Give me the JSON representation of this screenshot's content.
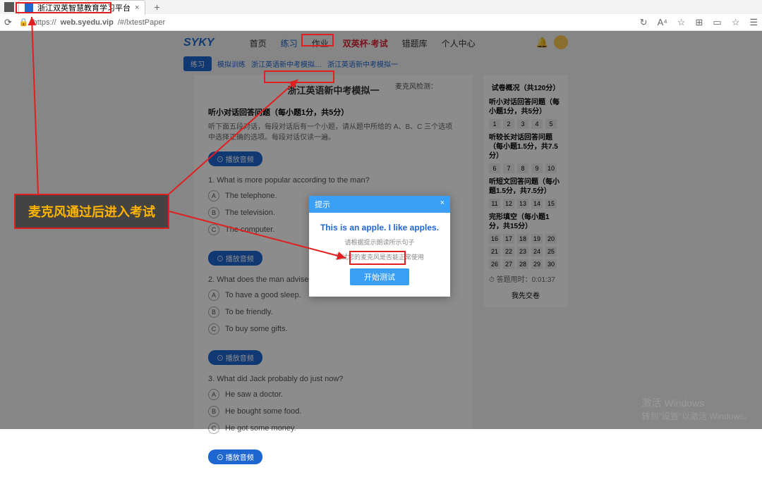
{
  "browser": {
    "tab_title": "浙江双英智慧教育学习平台",
    "tab_close": "×",
    "new_tab": "+",
    "reload": "⟳",
    "lock": "🔒",
    "url_prefix": "https://",
    "url_host": "web.syedu.vip",
    "url_path": "/#/lxtestPaper",
    "icons": {
      "sync": "↻",
      "aA": "A⁴",
      "star": "☆",
      "ext": "⊞",
      "book": "▭",
      "fav2": "☆",
      "user": "☰"
    }
  },
  "header": {
    "logo": "SYKY",
    "nav": {
      "home": "首页",
      "practice": "练习",
      "homework": "作业",
      "exam": "双英杯·考试",
      "resource": "错题库",
      "center": "个人中心"
    }
  },
  "breadcrumb": {
    "badge": "练习",
    "link1": "模拟训练",
    "link2": "浙江英语新中考模拟…",
    "link3": "浙江英语新中考模拟一"
  },
  "paper": {
    "title": "浙江英语新中考模拟一",
    "mic_check": "麦克风检测：",
    "section_title": "听小对话回答问题（每小题1分，共5分）",
    "section_desc": "听下面五段对话，每段对话后有一个小题，请从题中所给的 A、B、C 三个选项 中选择正确的选项。每段对话仅读一遍。",
    "audio_btn": "⊙ 播放音频",
    "q1": {
      "num": "1.",
      "text": "What is more popular according to the man?",
      "A": "The telephone.",
      "B": "The television.",
      "C": "The computer."
    },
    "q2": {
      "num": "2.",
      "text": "What does the man advise the gi...",
      "A": "To have a good sleep.",
      "B": "To be friendly.",
      "C": "To buy some gifts."
    },
    "q3": {
      "num": "3.",
      "text": "What did Jack probably do just now?",
      "A": "He saw a doctor.",
      "B": "He bought some food.",
      "C": "He got some money."
    }
  },
  "side": {
    "title": "试卷概况（共120分）",
    "sec1": "听小对话回答问题（每小题1分，共5分）",
    "row1": [
      "1",
      "2",
      "3",
      "4",
      "5"
    ],
    "sec2": "听较长对话回答问题（每小题1.5分，共7.5分）",
    "row2": [
      "6",
      "7",
      "8",
      "9",
      "10"
    ],
    "sec3": "听短文回答问题（每小题1.5分，共7.5分）",
    "row3": [
      "11",
      "12",
      "13",
      "14",
      "15"
    ],
    "sec4": "完形填空（每小题1分，共15分）",
    "row4a": [
      "16",
      "17",
      "18",
      "19",
      "20"
    ],
    "row4b": [
      "21",
      "22",
      "23",
      "24",
      "25"
    ],
    "row4c": [
      "26",
      "27",
      "28",
      "29",
      "30"
    ],
    "timer_label": "⏱ 答题用时：",
    "timer_value": "0:01:37",
    "submit": "我先交卷"
  },
  "modal": {
    "head": "提示",
    "close": "×",
    "sentence": "This is an apple. I like apples.",
    "hint1": "请根据提示朗读所示句子",
    "hint2": "测试您的麦克风是否能正常使用",
    "btn": "开始测试"
  },
  "annot": {
    "label": "麦克风通过后进入考试"
  },
  "watermark": {
    "line1": "激活 Windows",
    "line2": "转到\"设置\"以激活 Windows。"
  }
}
